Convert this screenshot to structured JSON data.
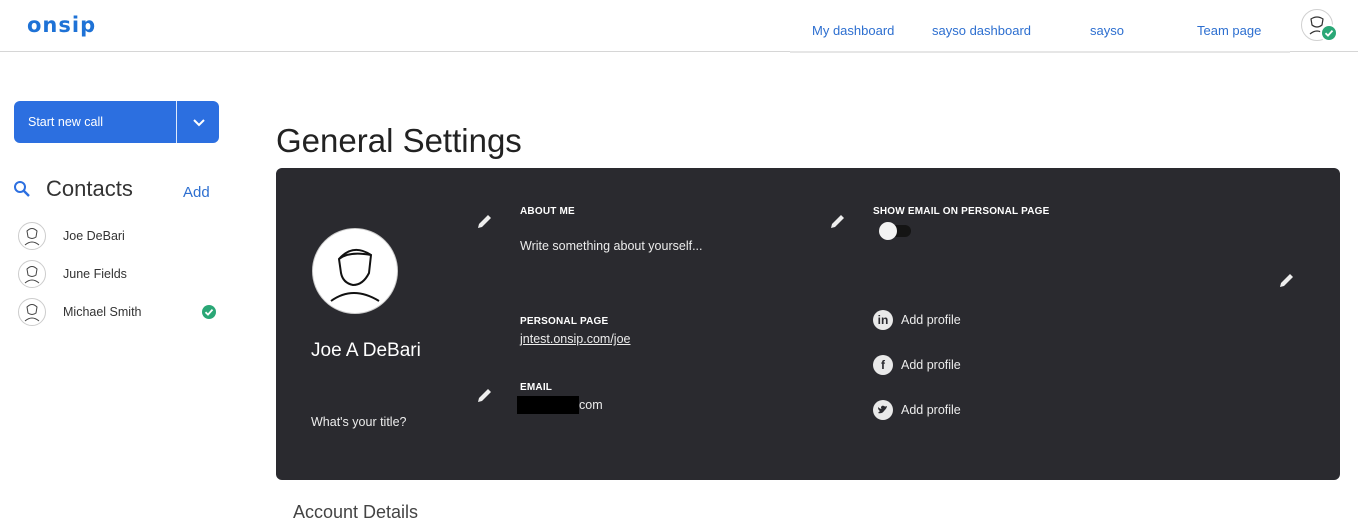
{
  "header": {
    "logo": "onsip",
    "nav": [
      "My dashboard",
      "sayso dashboard",
      "sayso",
      "Team page"
    ]
  },
  "sidebar": {
    "call_button_label": "Start new call",
    "contacts_title": "Contacts",
    "add_label": "Add",
    "contacts": [
      {
        "name": "Joe DeBari",
        "status": "none"
      },
      {
        "name": "June Fields",
        "status": "none"
      },
      {
        "name": "Michael Smith",
        "status": "available"
      }
    ]
  },
  "main": {
    "page_title": "General Settings",
    "profile": {
      "name": "Joe A DeBari",
      "title_placeholder": "What's your title?"
    },
    "about": {
      "label": "ABOUT ME",
      "text": "Write something about yourself..."
    },
    "personal_page": {
      "label": "PERSONAL PAGE",
      "url": "jntest.onsip.com/joe"
    },
    "email": {
      "label": "EMAIL",
      "value_suffix": "com"
    },
    "show_email": {
      "label": "SHOW EMAIL ON PERSONAL PAGE",
      "enabled": false
    },
    "social": [
      {
        "network": "linkedin",
        "label": "Add profile"
      },
      {
        "network": "facebook",
        "label": "Add profile"
      },
      {
        "network": "twitter",
        "label": "Add profile"
      }
    ],
    "account_title": "Account Details"
  },
  "colors": {
    "accent": "#2c6fe0",
    "link": "#2d6fd0",
    "card_bg": "#2a2a2f",
    "status_green": "#2aa776"
  }
}
